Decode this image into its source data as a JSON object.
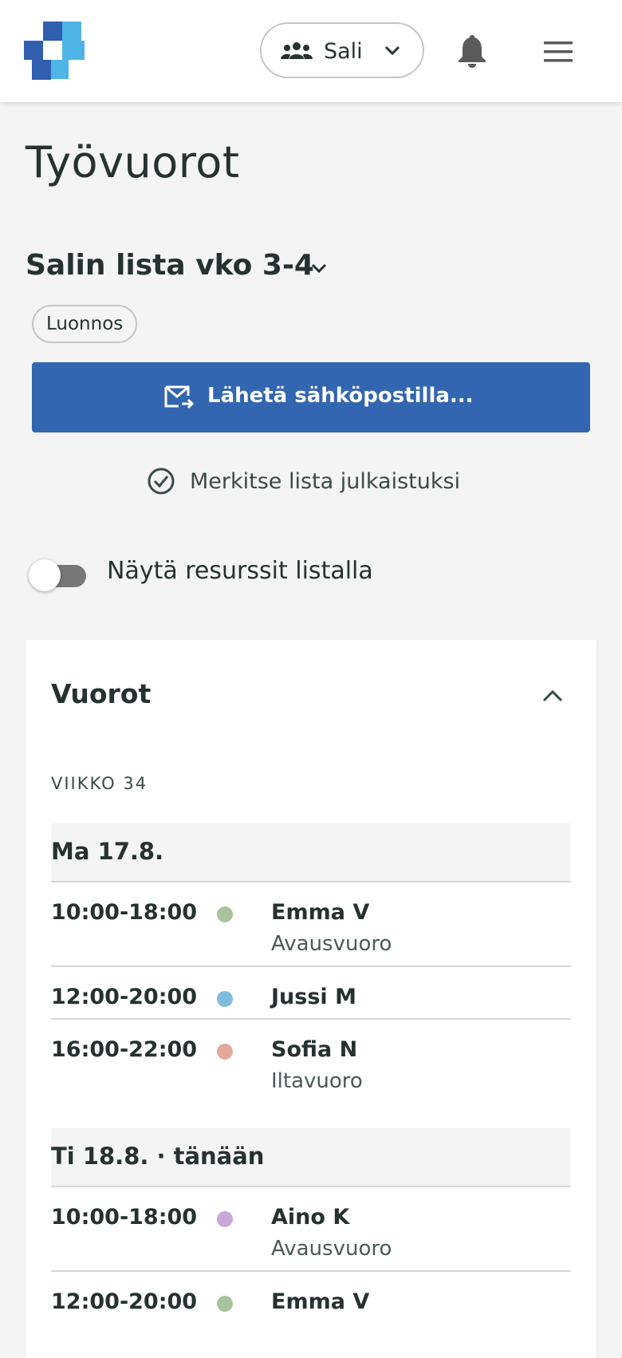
{
  "header": {
    "logo_icon": "app-logo",
    "group_icon": "people-icon",
    "group_label": "Sali",
    "notification_icon": "bell-icon",
    "menu_icon": "hamburger-menu-icon"
  },
  "page": {
    "title": "Työvuorot",
    "list_title": "Salin lista vko 3-4",
    "status": "Luonnos",
    "send_button": "Lähetä sähköpostilla...",
    "mark_published": "Merkitse lista julkaistuksi",
    "toggle_label": "Näytä resurssit listalla",
    "toggle_on": false
  },
  "colors": {
    "primary": "#3366b0",
    "text": "#253230",
    "background": "#f4f4f4"
  },
  "shifts_card": {
    "title": "Vuorot",
    "week_label": "VIIKKO 34",
    "days": [
      {
        "label": "Ma 17.8.",
        "shifts": [
          {
            "time": "10:00-18:00",
            "name": "Emma V",
            "type": "Avausvuoro",
            "color": "#a8c39c"
          },
          {
            "time": "12:00-20:00",
            "name": "Jussi M",
            "type": "",
            "color": "#7fbbdc"
          },
          {
            "time": "16:00-22:00",
            "name": "Sofia N",
            "type": "Iltavuoro",
            "color": "#e2a99b"
          }
        ]
      },
      {
        "label": "Ti 18.8. · tänään",
        "shifts": [
          {
            "time": "10:00-18:00",
            "name": "Aino K",
            "type": "Avausvuoro",
            "color": "#c8a8d8"
          },
          {
            "time": "12:00-20:00",
            "name": "Emma V",
            "type": "",
            "color": "#a8c39c"
          }
        ]
      }
    ]
  }
}
